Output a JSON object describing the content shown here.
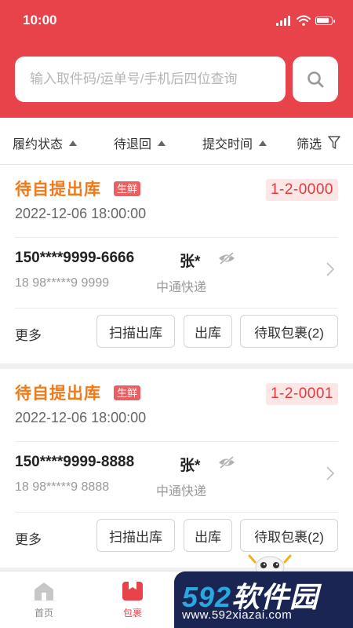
{
  "status_bar": {
    "time": "10:00"
  },
  "search": {
    "placeholder": "输入取件码/运单号/手机后四位查询"
  },
  "filters": [
    {
      "label": "履约状态"
    },
    {
      "label": "待退回"
    },
    {
      "label": "提交时间"
    },
    {
      "label": "筛选"
    }
  ],
  "orders": [
    {
      "status": "待自提出库",
      "tag": "生鲜",
      "pickup_code": "1-2-0000",
      "time": "2022-12-06 18:00:00",
      "phone": "150****9999-6666",
      "name": "张*",
      "sub_phone": "18 98*****9 9999",
      "courier": "中通快递",
      "more_label": "更多",
      "actions": [
        "扫描出库",
        "出库",
        "待取包裹(2)"
      ]
    },
    {
      "status": "待自提出库",
      "tag": "生鲜",
      "pickup_code": "1-2-0001",
      "time": "2022-12-06 18:00:00",
      "phone": "150****9999-8888",
      "name": "张*",
      "sub_phone": "18 98*****9 8888",
      "courier": "中通快递",
      "more_label": "更多",
      "actions": [
        "扫描出库",
        "出库",
        "待取包裹(2)"
      ]
    }
  ],
  "tab_bar": [
    {
      "label": "首页",
      "active": false
    },
    {
      "label": "包裹",
      "active": true
    }
  ],
  "watermark": {
    "brand_num": "592",
    "brand_text": "软件园",
    "url": "www.592xiazai.com"
  },
  "colors": {
    "primary": "#e8434a",
    "status_orange": "#f07a1b",
    "code_bg": "#fde6e6",
    "code_text": "#e03a3e"
  }
}
